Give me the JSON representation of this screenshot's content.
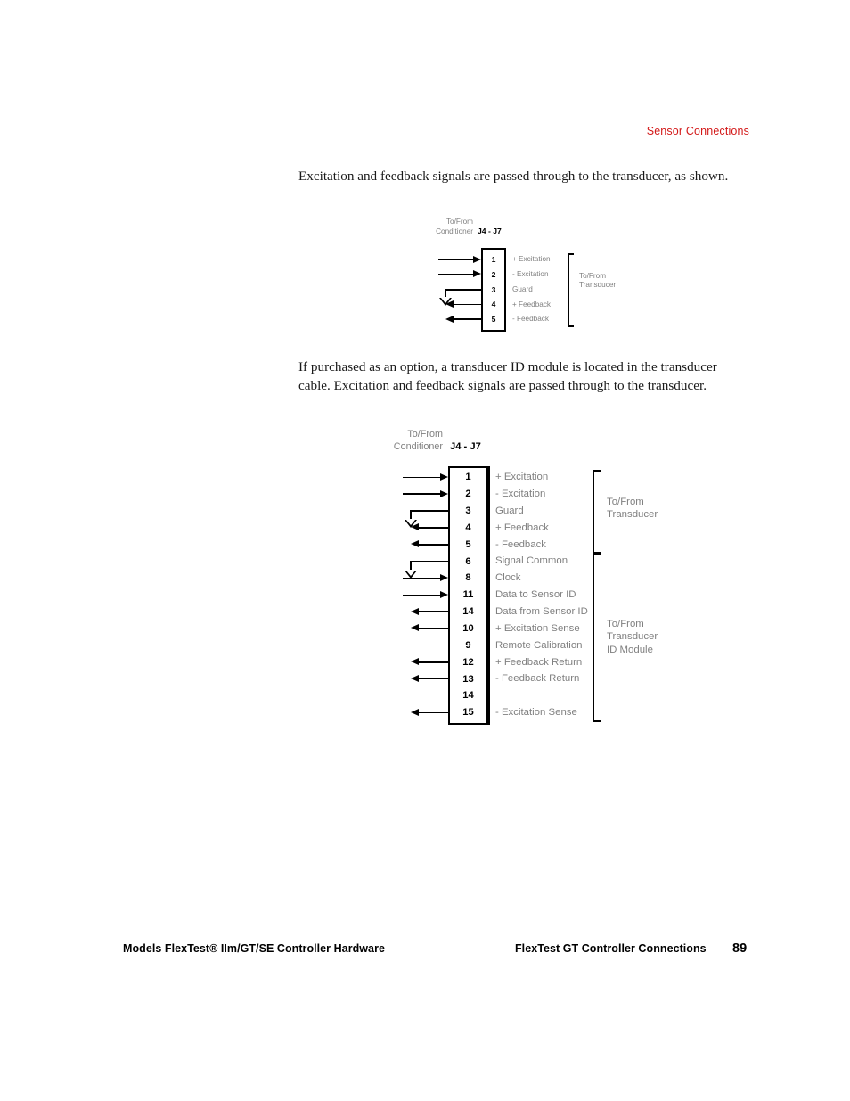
{
  "running_head": "Sensor Connections",
  "paragraphs": {
    "p1": "Excitation and feedback signals are passed through to the transducer, as shown.",
    "p2": "If purchased as an option, a transducer ID module is located in the transducer cable. Excitation and feedback signals are passed through to the transducer."
  },
  "diagram1": {
    "source_label_line1": "To/From",
    "source_label_line2": "Conditioner",
    "connector_label": "J4 - J7",
    "target_label_line1": "To/From",
    "target_label_line2": "Transducer",
    "pins": [
      {
        "num": "1",
        "label": "+ Excitation",
        "dir": "in"
      },
      {
        "num": "2",
        "label": "-  Excitation",
        "dir": "in"
      },
      {
        "num": "3",
        "label": "Guard",
        "dir": "ground"
      },
      {
        "num": "4",
        "label": "+ Feedback",
        "dir": "out"
      },
      {
        "num": "5",
        "label": "-  Feedback",
        "dir": "out"
      }
    ]
  },
  "diagram2": {
    "source_label_line1": "To/From",
    "source_label_line2": "Conditioner",
    "connector_label": "J4 - J7",
    "group1_label_line1": "To/From",
    "group1_label_line2": "Transducer",
    "group2_label_line1": "To/From",
    "group2_label_line2": "Transducer",
    "group2_label_line3": "ID Module",
    "pins": [
      {
        "num": "1",
        "label": "+ Excitation",
        "dir": "in"
      },
      {
        "num": "2",
        "label": "-  Excitation",
        "dir": "in"
      },
      {
        "num": "3",
        "label": "Guard",
        "dir": "ground"
      },
      {
        "num": "4",
        "label": "+ Feedback",
        "dir": "out"
      },
      {
        "num": "5",
        "label": "-  Feedback",
        "dir": "out"
      },
      {
        "num": "6",
        "label": "Signal Common",
        "dir": "ground"
      },
      {
        "num": "8",
        "label": "Clock",
        "dir": "in"
      },
      {
        "num": "11",
        "label": "Data to Sensor ID",
        "dir": "in"
      },
      {
        "num": "14",
        "label": "Data from Sensor ID",
        "dir": "out"
      },
      {
        "num": "10",
        "label": "+ Excitation Sense",
        "dir": "out"
      },
      {
        "num": "9",
        "label": "Remote Calibration",
        "dir": "none"
      },
      {
        "num": "12",
        "label": "+ Feedback Return",
        "dir": "out"
      },
      {
        "num": "13",
        "label": "-  Feedback Return",
        "dir": "out"
      },
      {
        "num": "14",
        "label": "",
        "dir": "none"
      },
      {
        "num": "15",
        "label": "-  Excitation Sense",
        "dir": "out"
      }
    ]
  },
  "footer": {
    "left": "Models FlexTest® IIm/GT/SE Controller Hardware",
    "right": "FlexTest GT Controller Connections",
    "page": "89"
  }
}
